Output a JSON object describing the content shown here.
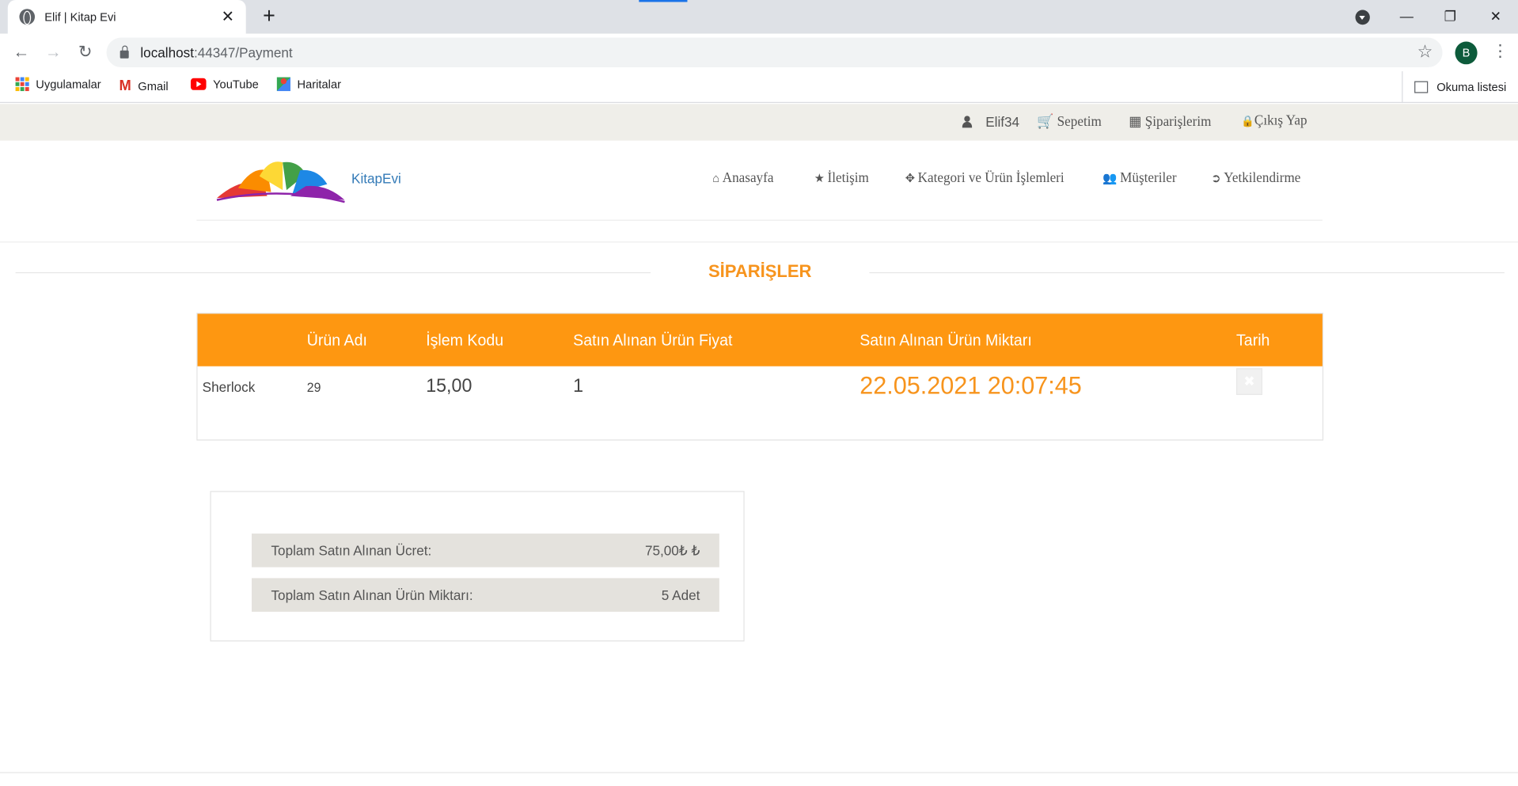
{
  "browser": {
    "tab_title": "Elif | Kitap Evi",
    "url_host": "localhost",
    "url_rest": ":44347/Payment",
    "profile_initial": "B",
    "bookmarks": [
      "Uygulamalar",
      "Gmail",
      "YouTube",
      "Haritalar"
    ],
    "reading_list": "Okuma listesi"
  },
  "topbar": {
    "username": "Elif34",
    "cart": "Sepetim",
    "orders": "Şiparişlerim",
    "logout": "Çıkış Yap"
  },
  "header": {
    "brand": "KitapEvi",
    "nav": [
      "Anasayfa",
      "İletişim",
      "Kategori ve Ürün İşlemleri",
      "Müşteriler",
      "Yetkilendirme"
    ]
  },
  "section_title": "SİPARİŞLER",
  "table": {
    "headers": [
      "Ürün Adı",
      "İşlem Kodu",
      "Satın Alınan Ürün Fiyat",
      "Satın Alınan Ürün Miktarı",
      "Tarih"
    ],
    "row": {
      "product": "Sherlock",
      "code": "29",
      "price": "15,00",
      "quantity": "1",
      "date": "22.05.2021 20:07:45"
    }
  },
  "summary": {
    "total_price_label": "Toplam Satın Alınan Ücret:",
    "total_price_value": "75,00₺ ₺",
    "total_qty_label": "Toplam Satın Alınan Ürün Miktarı:",
    "total_qty_value": "5 Adet"
  },
  "colors": {
    "accent": "#fe9711",
    "title_orange": "#f7941d",
    "brand_blue": "#337ab7",
    "topbar_bg": "#efeee9"
  }
}
